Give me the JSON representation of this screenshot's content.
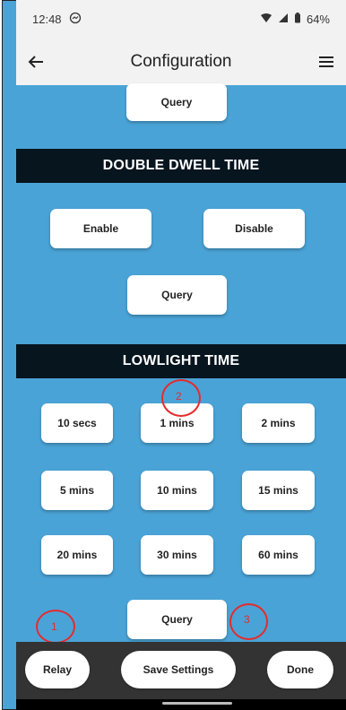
{
  "status_bar": {
    "time": "12:48",
    "battery": "64%",
    "messenger_icon": "messenger-icon",
    "wifi_icon": "wifi-icon",
    "signal_icon": "signal-icon",
    "battery_icon": "battery-icon"
  },
  "app_bar": {
    "title": "Configuration",
    "back_icon": "back-arrow-icon",
    "menu_icon": "menu-icon"
  },
  "top": {
    "query_label": "Query"
  },
  "double_dwell": {
    "title": "DOUBLE DWELL TIME",
    "enable_label": "Enable",
    "disable_label": "Disable",
    "query_label": "Query"
  },
  "lowlight": {
    "title": "LOWLIGHT TIME",
    "options": [
      "10 secs",
      "1 mins",
      "2 mins",
      "5 mins",
      "10 mins",
      "15 mins",
      "20 mins",
      "30 mins",
      "60 mins"
    ],
    "query_label": "Query"
  },
  "annotations": [
    "1",
    "2",
    "3"
  ],
  "bottom_bar": {
    "relay_label": "Relay",
    "save_label": "Save Settings",
    "done_label": "Done"
  },
  "colors": {
    "accent_blue": "#4aa3d6",
    "section_bg": "#07151f",
    "annotation_red": "#e52b2b",
    "bottom_bar_bg": "#333333"
  }
}
